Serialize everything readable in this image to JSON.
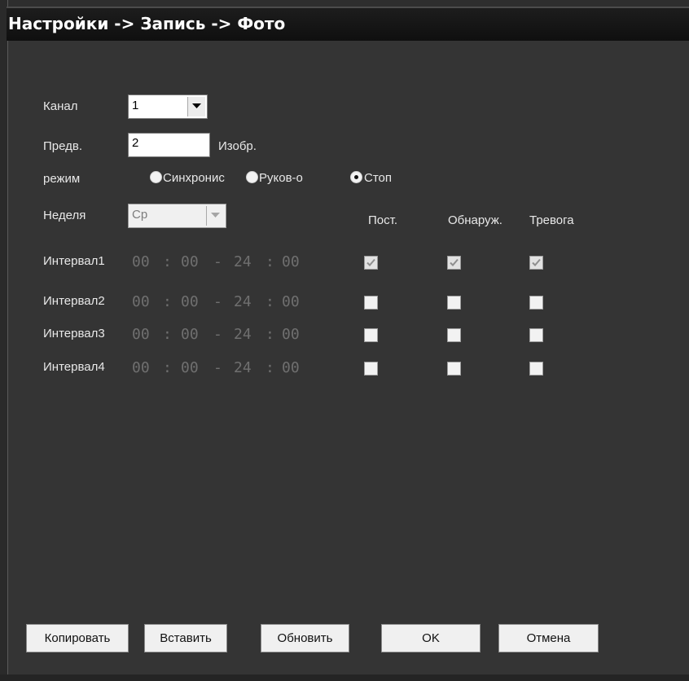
{
  "window": {
    "title": "Настройки -> Запись -> Фото"
  },
  "form": {
    "channel": {
      "label": "Канал",
      "value": "1"
    },
    "prerecord": {
      "label": "Предв.",
      "value": "2",
      "unit": "Изобр."
    },
    "mode": {
      "label": "режим",
      "options": [
        "Синхронис",
        "Руков-о",
        "Стоп"
      ],
      "selected": "Стоп"
    },
    "week": {
      "label": "Неделя",
      "value": "Ср"
    },
    "columns": [
      "Пост.",
      "Обнаруж.",
      "Тревога"
    ],
    "intervals": [
      {
        "label": "Интервал1",
        "start_h": "00",
        "start_m": "00",
        "end_h": "24",
        "end_m": "00",
        "checks": [
          true,
          true,
          true
        ]
      },
      {
        "label": "Интервал2",
        "start_h": "00",
        "start_m": "00",
        "end_h": "24",
        "end_m": "00",
        "checks": [
          false,
          false,
          false
        ]
      },
      {
        "label": "Интервал3",
        "start_h": "00",
        "start_m": "00",
        "end_h": "24",
        "end_m": "00",
        "checks": [
          false,
          false,
          false
        ]
      },
      {
        "label": "Интервал4",
        "start_h": "00",
        "start_m": "00",
        "end_h": "24",
        "end_m": "00",
        "checks": [
          false,
          false,
          false
        ]
      }
    ],
    "time_separator": ":",
    "range_separator": "-"
  },
  "buttons": {
    "copy": "Копировать",
    "paste": "Вставить",
    "refresh": "Обновить",
    "ok": "OK",
    "cancel": "Отмена"
  },
  "colors": {
    "background": "#343434",
    "title_bar": "#141414",
    "text": "#e8e8e8",
    "disabled_time": "#6f6f6f"
  }
}
